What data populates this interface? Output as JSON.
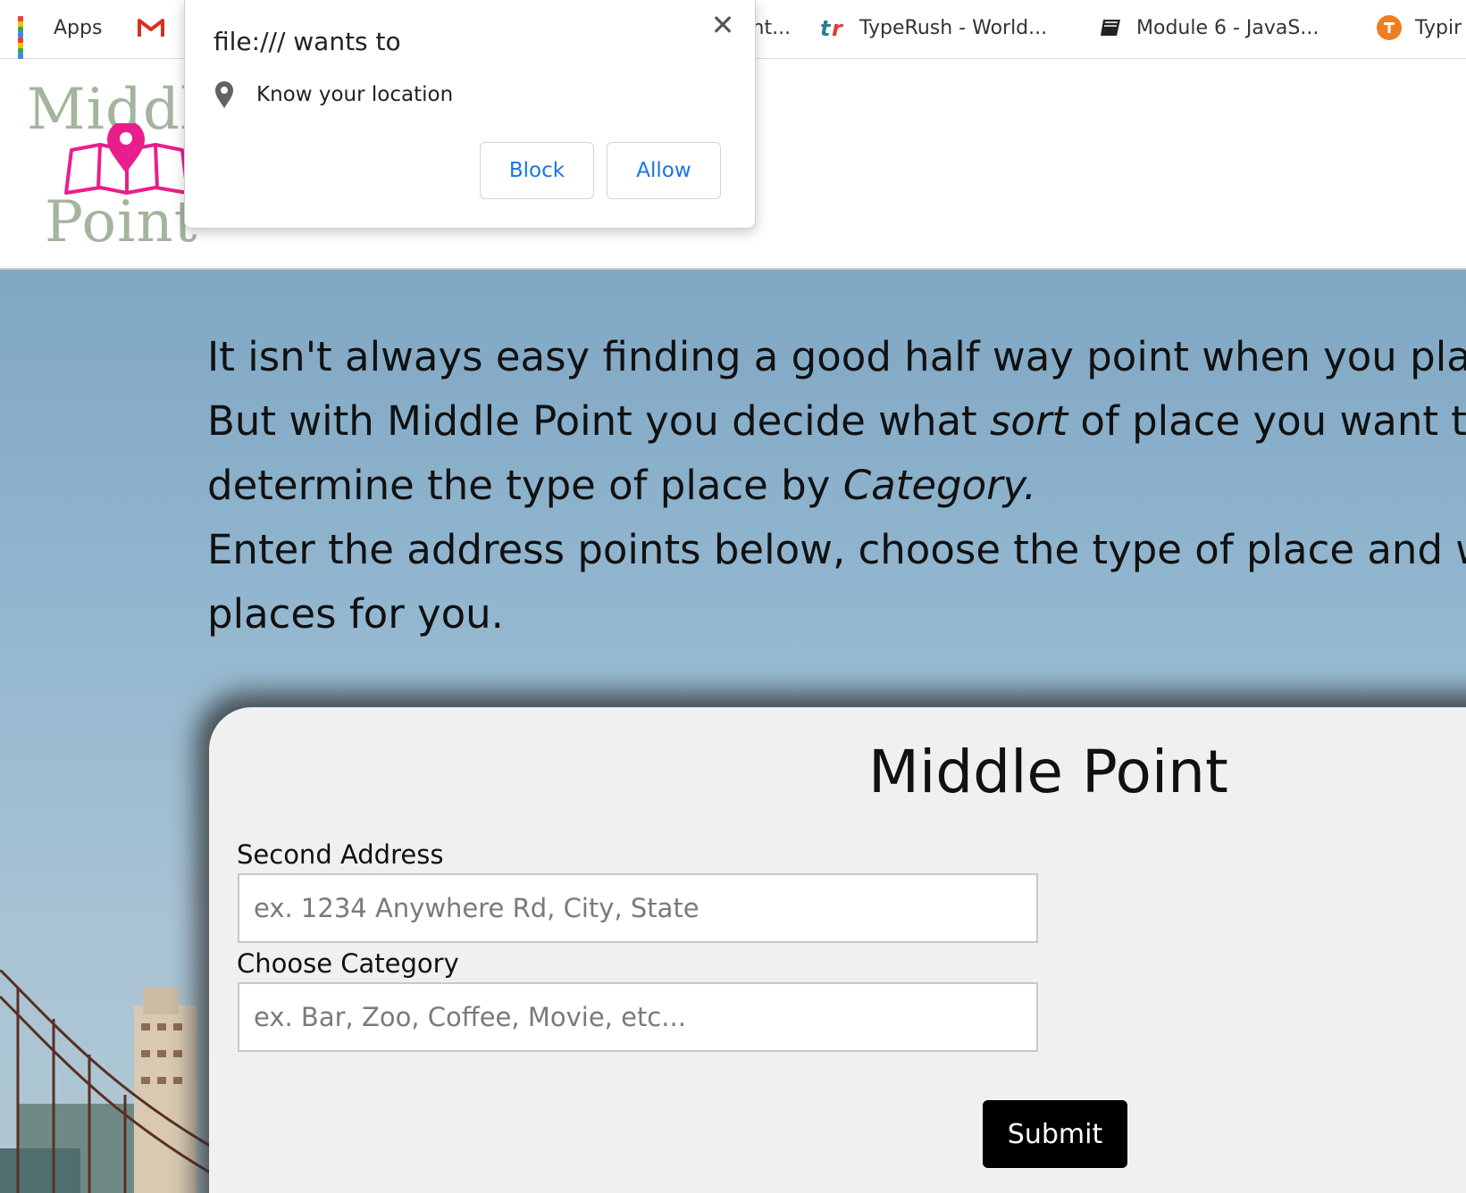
{
  "bookmarks": [
    {
      "label": "Apps",
      "icon": "apps-grid-icon"
    },
    {
      "label": "",
      "icon": "gmail-icon"
    },
    {
      "label": "ent...",
      "icon": ""
    },
    {
      "label": "TypeRush - World...",
      "icon": "typerush-icon"
    },
    {
      "label": "Module 6 - JavaS...",
      "icon": "book-icon"
    },
    {
      "label": "Typir",
      "icon": "typing-icon"
    }
  ],
  "logo": {
    "line1": "Middl",
    "line2": "Point"
  },
  "intro": {
    "line1": "It isn't always easy finding a good half way point when you plan c",
    "line2_pre": "But with Middle Point you decide what ",
    "line2_em": "sort",
    "line2_post": " of place you want to",
    "line3_pre": "determine the type of place by ",
    "line3_em": "Category.",
    "line4": "Enter the address points below, choose the type of place and we",
    "line5": "places for you."
  },
  "form": {
    "title": "Middle Point",
    "address_label": "Second Address",
    "address_placeholder": "ex. 1234 Anywhere Rd, City, State",
    "category_label": "Choose Category",
    "category_placeholder": "ex. Bar, Zoo, Coffee, Movie, etc...",
    "submit_label": "Submit"
  },
  "popup": {
    "title": "file:/// wants to",
    "close": "✕",
    "permission": "Know your location",
    "block_label": "Block",
    "allow_label": "Allow"
  },
  "colors": {
    "accent": "#1a73e8",
    "logo_pink": "#e91e8c",
    "logo_sage": "#a3b59c"
  }
}
